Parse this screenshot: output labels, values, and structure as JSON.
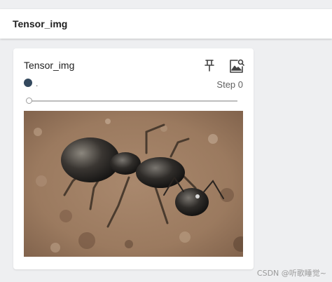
{
  "header": {
    "title": "Tensor_img"
  },
  "card": {
    "title": "Tensor_img",
    "run": {
      "name": ".",
      "color": "#34495e"
    },
    "step_label": "Step 0",
    "slider_value": 0
  },
  "image": {
    "subject": "ant on soil (photo)"
  },
  "icons": {
    "pin": "pin-icon",
    "image_action": "image-search-icon"
  },
  "watermark": "CSDN @听歌睡觉~"
}
